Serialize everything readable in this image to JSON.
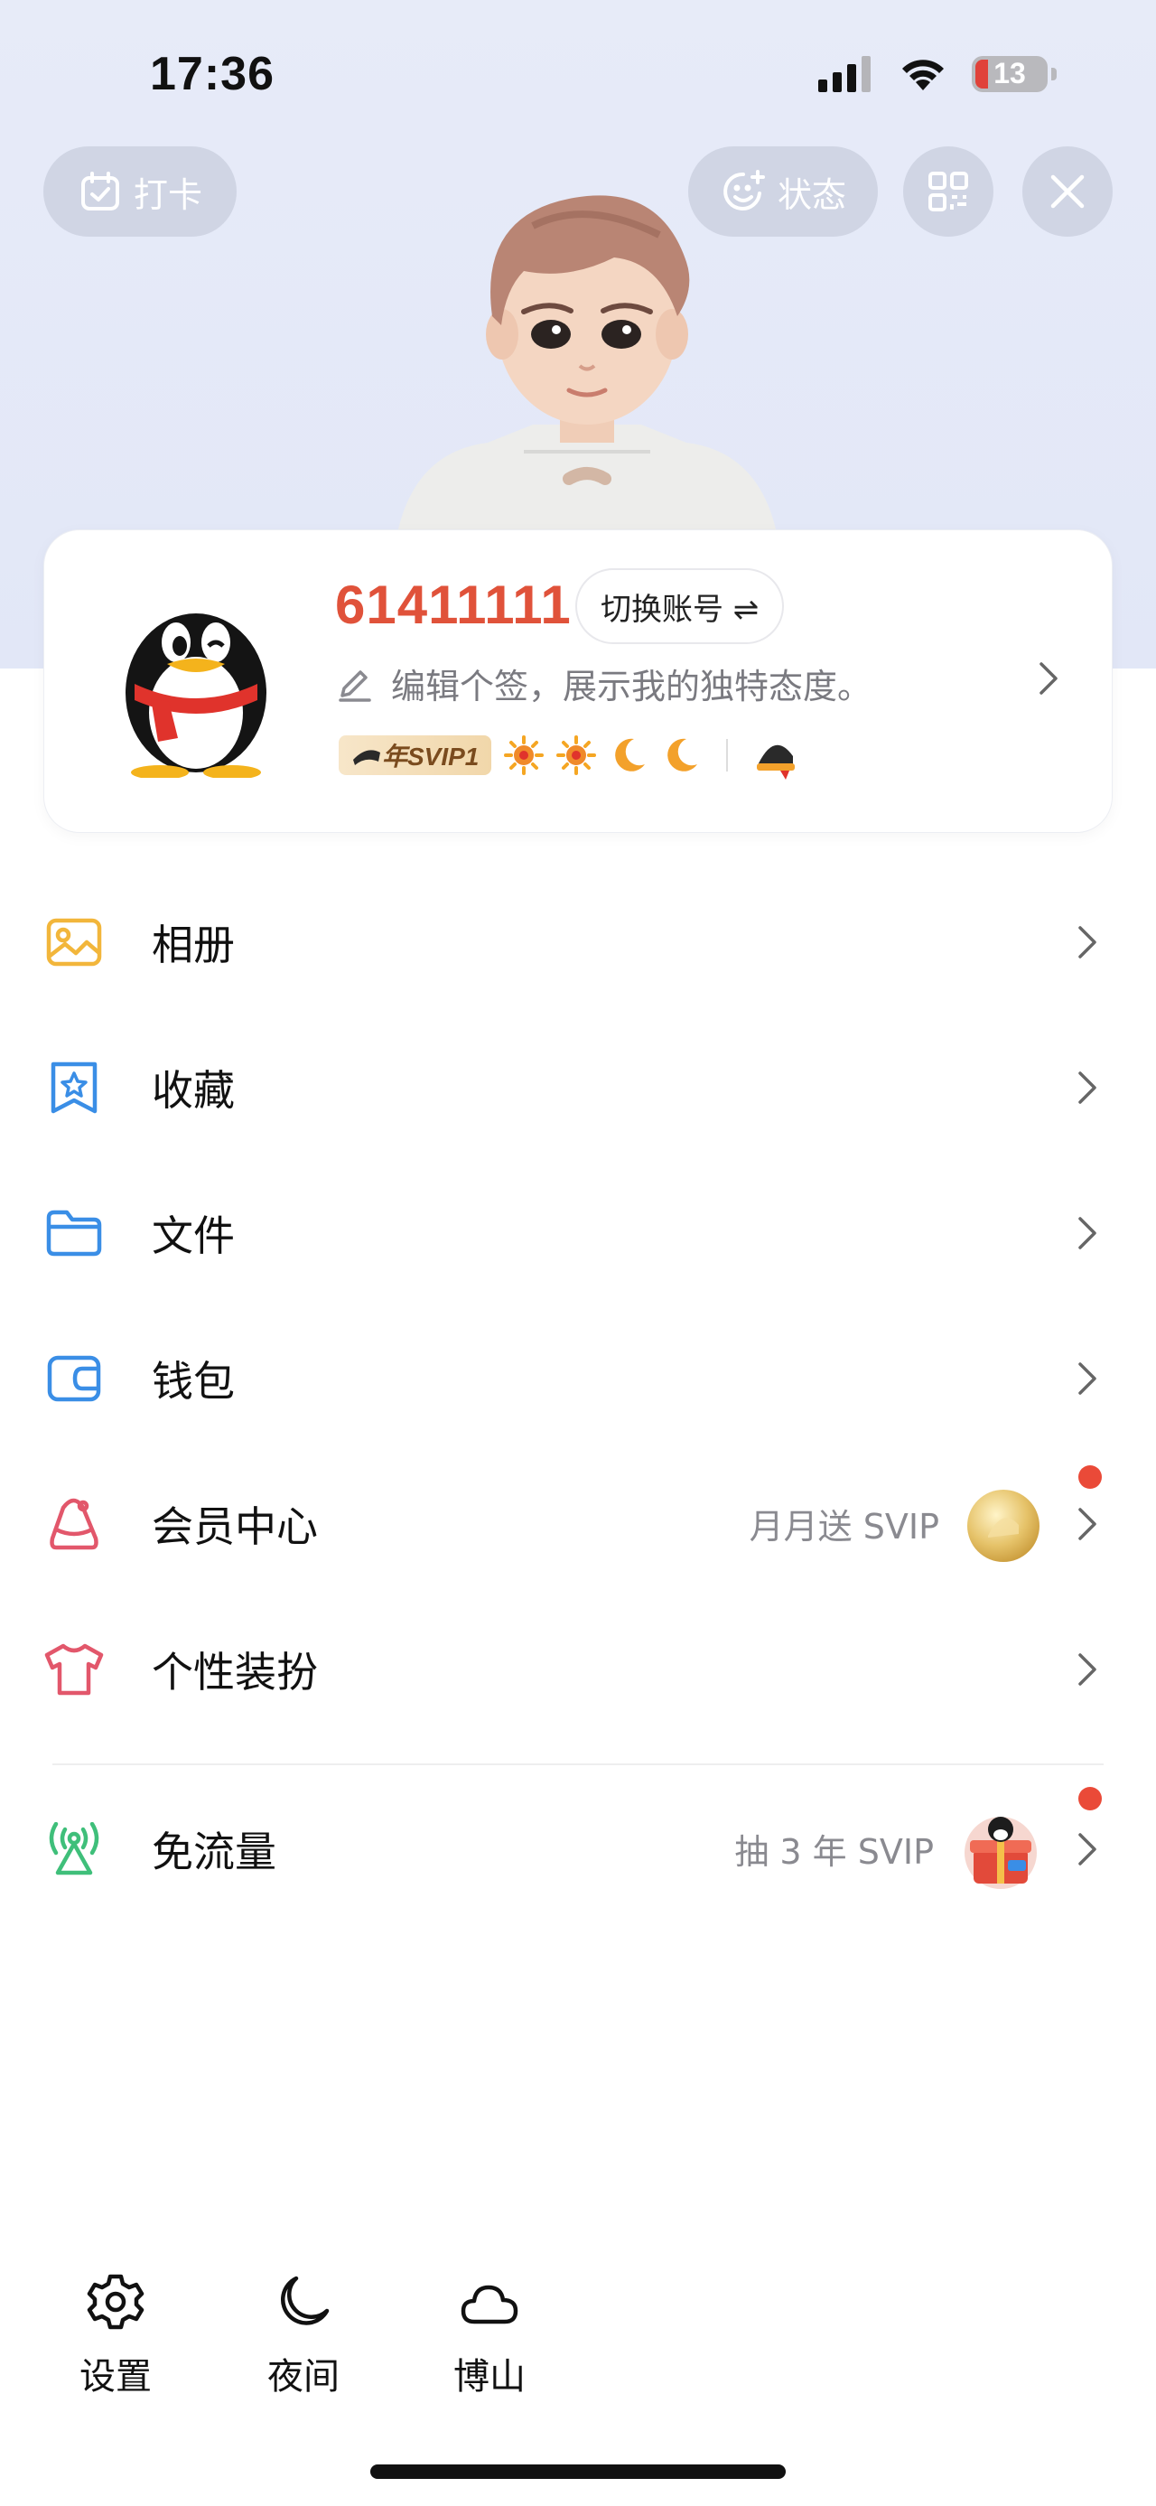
{
  "status_bar": {
    "time": "17:36",
    "battery": "13"
  },
  "top_actions": {
    "checkin_label": "打卡",
    "status_label": "状态"
  },
  "profile": {
    "qq_number": "61411111",
    "switch_account_label": "切换账号 ⇌",
    "signature_placeholder": "编辑个签，展示我的独特态度。",
    "svip_badge": "年SVIP1"
  },
  "menu": {
    "items": [
      {
        "label": "相册",
        "icon": "photo-album-icon",
        "color": "#f2b63b"
      },
      {
        "label": "收藏",
        "icon": "favorites-icon",
        "color": "#3a8ee6"
      },
      {
        "label": "文件",
        "icon": "folder-icon",
        "color": "#3a8ee6"
      },
      {
        "label": "钱包",
        "icon": "wallet-icon",
        "color": "#3a8ee6"
      },
      {
        "label": "会员中心",
        "icon": "vip-icon",
        "color": "#e2576b",
        "hint": "月月送 SVIP"
      },
      {
        "label": "个性装扮",
        "icon": "tshirt-icon",
        "color": "#e2576b"
      },
      {
        "label": "免流量",
        "icon": "antenna-icon",
        "color": "#3fbf7a",
        "hint": "抽 3 年 SVIP"
      }
    ]
  },
  "bottom_bar": {
    "settings_label": "设置",
    "night_label": "夜间",
    "weather_label": "博山"
  },
  "colors": {
    "accent_red": "#e0523a",
    "hero_bg": "#e4e8f7",
    "notification_dot": "#ea4a38"
  }
}
